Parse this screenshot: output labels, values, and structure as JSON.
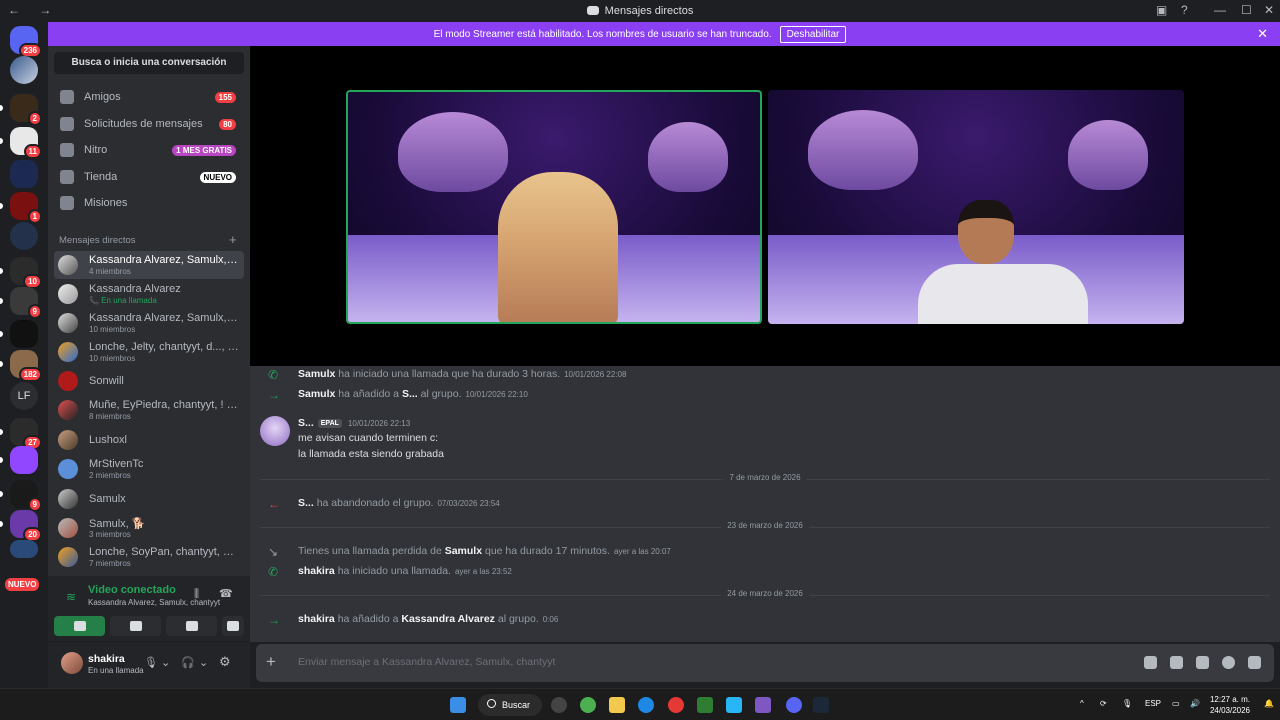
{
  "window": {
    "title": "Mensajes directos",
    "nav": "← →"
  },
  "banner": {
    "text": "El modo Streamer está habilitado. Los nombres de usuario se han truncado.",
    "button": "Deshabilitar"
  },
  "guilds": {
    "badges": [
      "236",
      "2",
      "11",
      "1",
      "10",
      "9",
      "182",
      "27",
      "9",
      "20"
    ],
    "lf": "LF",
    "nuevo": "NUEVO"
  },
  "sidebar": {
    "search": "Busca o inicia una conversación",
    "nav": [
      {
        "label": "Amigos",
        "badge": "155"
      },
      {
        "label": "Solicitudes de mensajes",
        "badge": "80"
      },
      {
        "label": "Nitro",
        "badge": "1 MES GRATIS"
      },
      {
        "label": "Tienda",
        "badge": "NUEVO"
      },
      {
        "label": "Misiones",
        "badge": ""
      }
    ],
    "dm_header": "Mensajes directos",
    "dms": [
      {
        "name": "Kassandra Alvarez, Samulx, cha...",
        "sub": "4 miembros"
      },
      {
        "name": "Kassandra Alvarez",
        "sub": "📞 En una llamada"
      },
      {
        "name": "Kassandra Alvarez, Samulx, B...",
        "sub": "10 miembros"
      },
      {
        "name": "Lonche, Jelty, chantyyt, d..., Sa...",
        "sub": "10 miembros"
      },
      {
        "name": "Sonwill",
        "sub": ""
      },
      {
        "name": "Muñe, EyPiedra, chantyyt, ! JU...",
        "sub": "8 miembros"
      },
      {
        "name": "Lushoxl",
        "sub": ""
      },
      {
        "name": "MrStivenTc",
        "sub": "2 miembros"
      },
      {
        "name": "Samulx",
        "sub": ""
      },
      {
        "name": "Samulx, 🐕",
        "sub": "3 miembros"
      },
      {
        "name": "Lonche, SoyPan, chantyyt, Willi...",
        "sub": "7 miembros"
      }
    ]
  },
  "voice": {
    "status": "Video conectado",
    "channel": "Kassandra Alvarez, Samulx, chantyyt"
  },
  "user": {
    "name": "shakira",
    "status": "En una llamada"
  },
  "chat": {
    "sys1": {
      "who": "Samulx",
      "text": "ha iniciado una llamada que ha durado 3 horas.",
      "ts": "10/01/2026 22:08"
    },
    "sys2": {
      "who": "Samulx",
      "text": "ha añadido a",
      "target": "S...",
      "tail": "al grupo.",
      "ts": "10/01/2026 22:10"
    },
    "msg": {
      "author": "S...",
      "tag": "EPAL",
      "ts": "10/01/2026 22:13",
      "lines": [
        "me avisan cuando terminen c:",
        "la llamada esta siendo grabada"
      ]
    },
    "date1": "7 de marzo de 2026",
    "sys3": {
      "who": "S...",
      "text": "ha abandonado el grupo.",
      "ts": "07/03/2026 23:54"
    },
    "date2": "23 de marzo de 2026",
    "sys4": {
      "pre": "Tienes una llamada perdida de",
      "who": "Samulx",
      "text": "que ha durado 17 minutos.",
      "ts": "ayer a las 20:07"
    },
    "sys5": {
      "who": "shakira",
      "text": "ha iniciado una llamada.",
      "ts": "ayer a las 23:52"
    },
    "date3": "24 de marzo de 2026",
    "sys6": {
      "who": "shakira",
      "text": "ha añadido a",
      "target": "Kassandra Alvarez",
      "tail": "al grupo.",
      "ts": "0:06"
    }
  },
  "composer": {
    "placeholder": "Enviar mensaje a Kassandra Alvarez, Samulx, chantyyt"
  },
  "taskbar": {
    "search": "Buscar",
    "lang": "ESP",
    "time": "12:27 a. m.",
    "date": "24/03/2026"
  }
}
